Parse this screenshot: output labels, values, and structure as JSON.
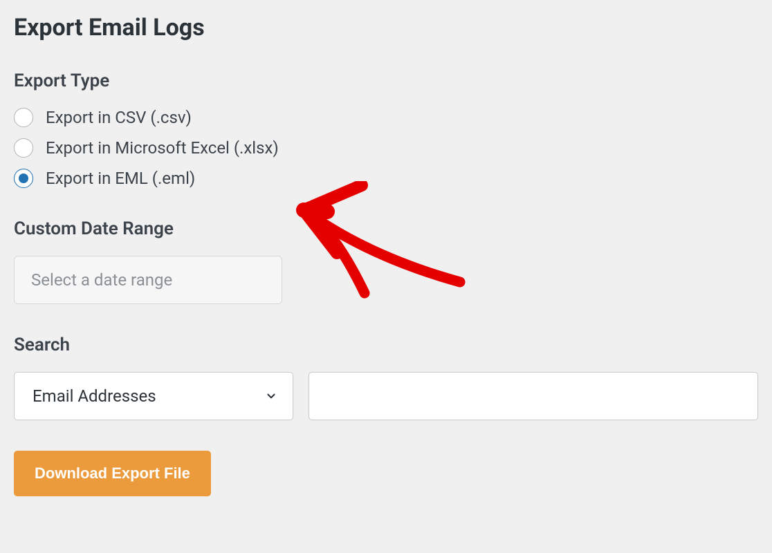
{
  "page_title": "Export Email Logs",
  "export_type": {
    "heading": "Export Type",
    "options": [
      {
        "label": "Export in CSV (.csv)",
        "selected": false
      },
      {
        "label": "Export in Microsoft Excel (.xlsx)",
        "selected": false
      },
      {
        "label": "Export in EML (.eml)",
        "selected": true
      }
    ]
  },
  "date_range": {
    "heading": "Custom Date Range",
    "placeholder": "Select a date range"
  },
  "search": {
    "heading": "Search",
    "select_value": "Email Addresses",
    "text_value": ""
  },
  "download_button_label": "Download Export File",
  "annotation": {
    "type": "arrow",
    "color": "#e50000",
    "points_to": "export-type-option-2"
  }
}
